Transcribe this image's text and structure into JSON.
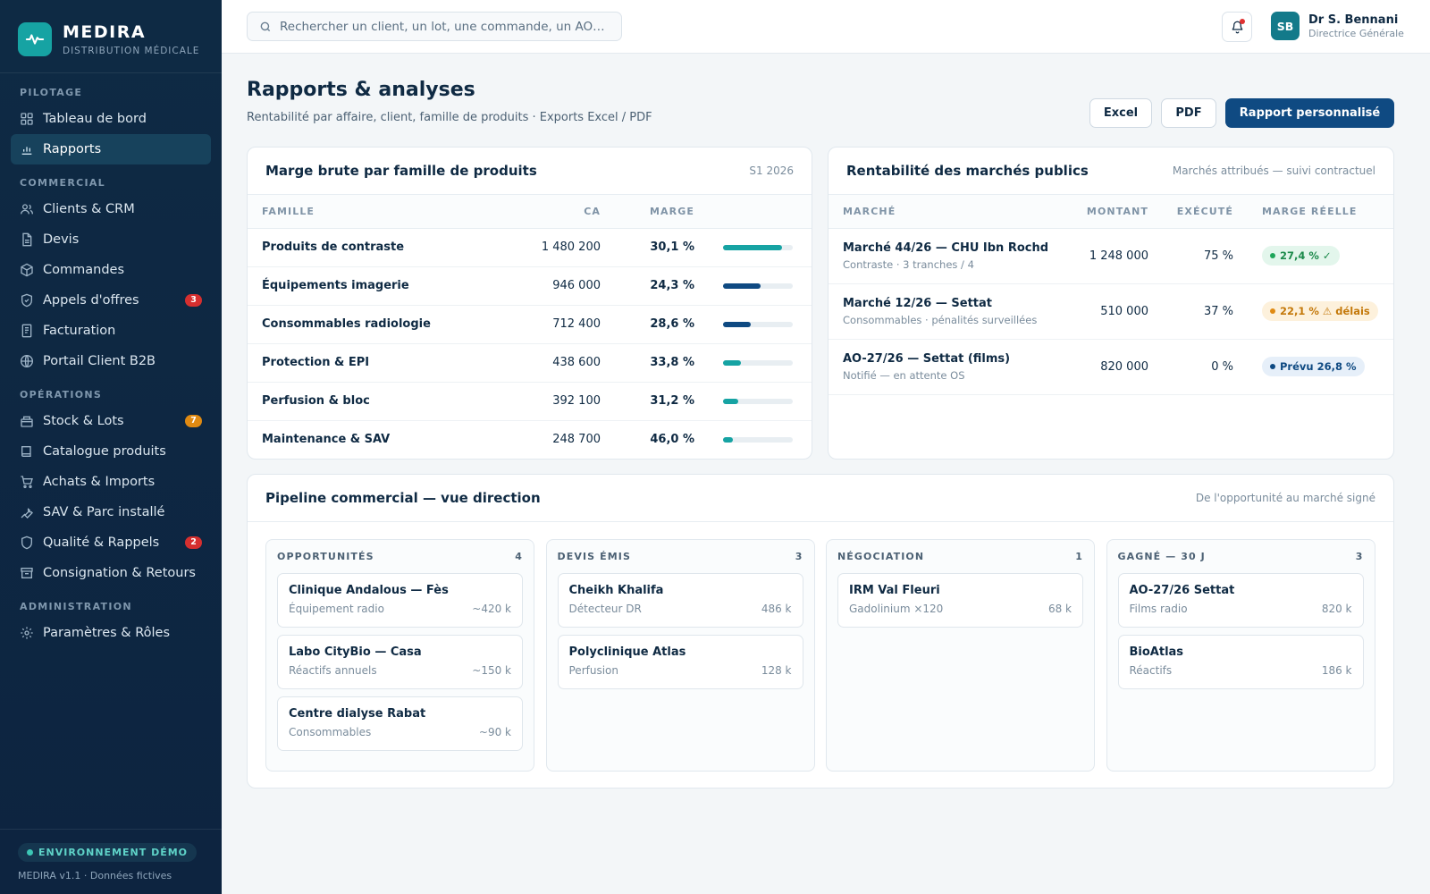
{
  "brand": {
    "name": "MEDIRA",
    "sub": "DISTRIBUTION MÉDICALE"
  },
  "sidebar": {
    "sections": [
      {
        "title": "PILOTAGE"
      },
      {
        "title": "COMMERCIAL"
      },
      {
        "title": "OPÉRATIONS"
      },
      {
        "title": "ADMINISTRATION"
      }
    ],
    "items": [
      {
        "label": "Tableau de bord",
        "icon": "dashboard-icon"
      },
      {
        "label": "Rapports",
        "icon": "bar-chart-icon",
        "active": true
      },
      {
        "label": "Clients & CRM",
        "icon": "users-icon"
      },
      {
        "label": "Devis",
        "icon": "document-icon"
      },
      {
        "label": "Commandes",
        "icon": "box-icon"
      },
      {
        "label": "Appels d'offres",
        "icon": "shield-icon",
        "badge": "3",
        "badge_color": "#d62f2f"
      },
      {
        "label": "Facturation",
        "icon": "invoice-icon"
      },
      {
        "label": "Portail Client B2B",
        "icon": "globe-icon"
      },
      {
        "label": "Stock & Lots",
        "icon": "box-stack-icon",
        "badge": "7",
        "badge_color": "#e08a12"
      },
      {
        "label": "Catalogue produits",
        "icon": "book-icon"
      },
      {
        "label": "Achats & Imports",
        "icon": "cart-icon"
      },
      {
        "label": "SAV & Parc installé",
        "icon": "wrench-icon"
      },
      {
        "label": "Qualité & Rappels",
        "icon": "shield-check-icon",
        "badge": "2",
        "badge_color": "#d62f2f"
      },
      {
        "label": "Consignation & Retours",
        "icon": "store-icon"
      },
      {
        "label": "Paramètres & Rôles",
        "icon": "gear-icon"
      }
    ],
    "footer": {
      "env": "ENVIRONNEMENT DÉMO",
      "version": "MEDIRA v1.1 · Données fictives"
    }
  },
  "topbar": {
    "search_placeholder": "Rechercher un client, un lot, une commande, un AO…",
    "user": {
      "initials": "SB",
      "name": "Dr S. Bennani",
      "role": "Directrice Générale"
    }
  },
  "page": {
    "title": "Rapports & analyses",
    "subtitle": "Rentabilité par affaire, client, famille de produits · Exports Excel / PDF",
    "buttons": {
      "excel": "Excel",
      "pdf": "PDF",
      "custom": "Rapport personnalisé"
    }
  },
  "margin_card": {
    "title": "Marge brute par famille de produits",
    "meta": "S1 2026",
    "headers": [
      "FAMILLE",
      "CA",
      "MARGE"
    ],
    "rows": [
      {
        "famille": "Produits de contraste",
        "ca": "1 480 200",
        "marge": "30,1 %",
        "bar": 0.85,
        "color": "#16a3a3"
      },
      {
        "famille": "Équipements imagerie",
        "ca": "946 000",
        "marge": "24,3 %",
        "bar": 0.54,
        "color": "#0f4a82"
      },
      {
        "famille": "Consommables radiologie",
        "ca": "712 400",
        "marge": "28,6 %",
        "bar": 0.4,
        "color": "#0f4a82"
      },
      {
        "famille": "Protection & EPI",
        "ca": "438 600",
        "marge": "33,8 %",
        "bar": 0.26,
        "color": "#16a3a3"
      },
      {
        "famille": "Perfusion & bloc",
        "ca": "392 100",
        "marge": "31,2 %",
        "bar": 0.22,
        "color": "#16a3a3"
      },
      {
        "famille": "Maintenance & SAV",
        "ca": "248 700",
        "marge": "46,0 %",
        "bar": 0.14,
        "color": "#16a3a3"
      }
    ]
  },
  "markets_card": {
    "title": "Rentabilité des marchés publics",
    "meta": "Marchés attribués — suivi contractuel",
    "headers": [
      "MARCHÉ",
      "MONTANT",
      "EXÉCUTÉ",
      "MARGE RÉELLE"
    ],
    "rows": [
      {
        "name": "Marché 44/26 — CHU Ibn Rochd",
        "detail": "Contraste · 3 tranches / 4",
        "montant": "1 248 000",
        "execute": "75 %",
        "marge": "27,4 % ✓",
        "bg": "#e3f6ec",
        "fg": "#1c8a4b",
        "dot": "#1fa55a"
      },
      {
        "name": "Marché 12/26 — Settat",
        "detail": "Consommables · pénalités surveillées",
        "montant": "510 000",
        "execute": "37 %",
        "marge": "22,1 % ⚠ délais",
        "bg": "#fdf1dc",
        "fg": "#c4790b",
        "dot": "#e08a12"
      },
      {
        "name": "AO-27/26 — Settat (films)",
        "detail": "Notifié — en attente OS",
        "montant": "820 000",
        "execute": "0 %",
        "marge": "Prévu 26,8 %",
        "bg": "#e6eff9",
        "fg": "#0f4a82",
        "dot": "#0f4a82"
      }
    ]
  },
  "pipeline": {
    "title": "Pipeline commercial — vue direction",
    "meta": "De l'opportunité au marché signé",
    "columns": [
      {
        "title": "OPPORTUNITÉS",
        "count": "4",
        "deals": [
          {
            "name": "Clinique Andalous — Fès",
            "detail": "Équipement radio",
            "value": "~420 k"
          },
          {
            "name": "Labo CityBio — Casa",
            "detail": "Réactifs annuels",
            "value": "~150 k"
          },
          {
            "name": "Centre dialyse Rabat",
            "detail": "Consommables",
            "value": "~90 k"
          }
        ]
      },
      {
        "title": "DEVIS ÉMIS",
        "count": "3",
        "deals": [
          {
            "name": "Cheikh Khalifa",
            "detail": "Détecteur DR",
            "value": "486 k"
          },
          {
            "name": "Polyclinique Atlas",
            "detail": "Perfusion",
            "value": "128 k"
          }
        ]
      },
      {
        "title": "NÉGOCIATION",
        "count": "1",
        "deals": [
          {
            "name": "IRM Val Fleuri",
            "detail": "Gadolinium ×120",
            "value": "68 k"
          }
        ]
      },
      {
        "title": "GAGNÉ — 30 J",
        "count": "3",
        "deals": [
          {
            "name": "AO-27/26 Settat",
            "detail": "Films radio",
            "value": "820 k"
          },
          {
            "name": "BioAtlas",
            "detail": "Réactifs",
            "value": "186 k"
          }
        ]
      }
    ]
  }
}
